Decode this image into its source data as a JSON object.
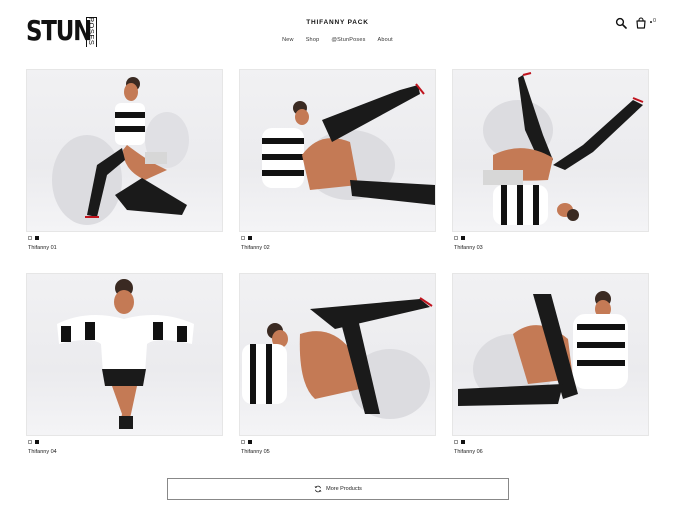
{
  "header": {
    "logo_text": "STUN",
    "logo_sub": "POSES",
    "title": "THIFANNY PACK",
    "nav": [
      {
        "label": "New"
      },
      {
        "label": "Shop"
      },
      {
        "label": "@StunPoses"
      },
      {
        "label": "About"
      }
    ],
    "cart_count": "0",
    "icons": {
      "search": "search-icon",
      "cart": "shopping-bag-icon"
    }
  },
  "products": [
    {
      "name": "Thifanny 01",
      "swatches": [
        "white",
        "black"
      ]
    },
    {
      "name": "Thifanny 02",
      "swatches": [
        "white",
        "black"
      ]
    },
    {
      "name": "Thifanny 03",
      "swatches": [
        "white",
        "black"
      ]
    },
    {
      "name": "Thifanny 04",
      "swatches": [
        "white",
        "black"
      ]
    },
    {
      "name": "Thifanny 05",
      "swatches": [
        "white",
        "black"
      ]
    },
    {
      "name": "Thifanny 06",
      "swatches": [
        "white",
        "black"
      ]
    }
  ],
  "more_button": {
    "label": "More Products",
    "icon": "refresh-icon"
  },
  "colors": {
    "accent": "#111111",
    "boot": "#1a1a1a",
    "sole": "#c0141e",
    "skin": "#c47a55",
    "fur": "#ffffff",
    "shadow": "#cfcfd4"
  }
}
